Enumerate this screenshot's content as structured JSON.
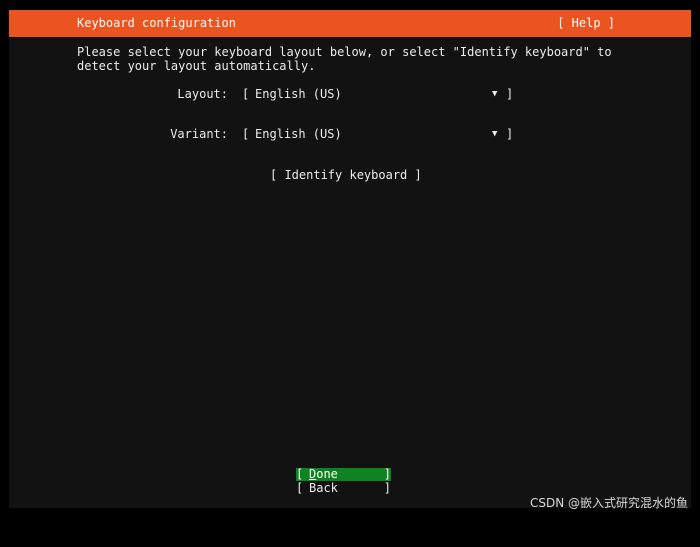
{
  "header": {
    "title": "Keyboard configuration",
    "help_label": "[ Help ]"
  },
  "instructions": {
    "line1": "Please select your keyboard layout below, or select \"Identify keyboard\" to",
    "line2": "detect your layout automatically."
  },
  "form": {
    "layout": {
      "label": "Layout:",
      "value": "English (US)",
      "open_bracket": "[",
      "close_bracket": "]",
      "arrow": "▼"
    },
    "variant": {
      "label": "Variant:",
      "value": "English (US)",
      "open_bracket": "[",
      "close_bracket": "]",
      "arrow": "▼"
    }
  },
  "identify_button": {
    "label": "[ Identify keyboard ]"
  },
  "footer": {
    "done": {
      "open_bracket": "[",
      "label_first": "D",
      "label_rest": "one",
      "close_bracket": "]"
    },
    "back": {
      "open_bracket": "[",
      "label": "Back",
      "close_bracket": "]"
    }
  },
  "watermark": {
    "text": "CSDN @嵌入式研究混水的鱼"
  },
  "colors": {
    "accent": "#e95420",
    "selected": "#0e8420",
    "background": "#121212"
  }
}
